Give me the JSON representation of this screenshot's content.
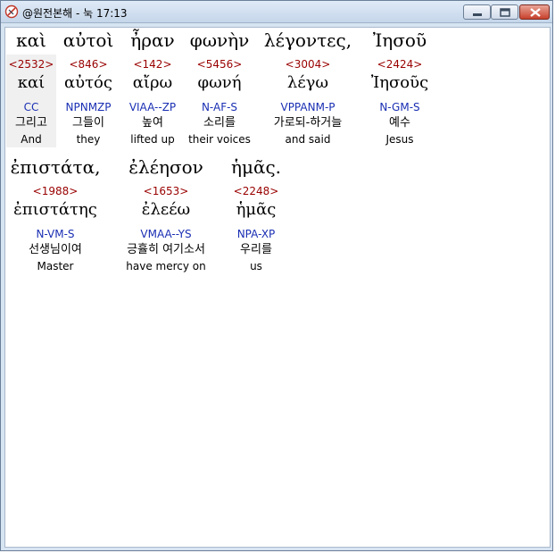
{
  "window": {
    "title": "@원전본해 - 눅 17:13"
  },
  "verse_rows": [
    {
      "words": [
        {
          "greek": "καὶ",
          "strong": "<2532>",
          "lemma": "καί",
          "morph": "CC",
          "korean": "그리고",
          "english": "And"
        },
        {
          "greek": "αὐτοὶ",
          "strong": "<846>",
          "lemma": "αὐτός",
          "morph": "NPNMZP",
          "korean": "그들이",
          "english": "they"
        },
        {
          "greek": "ἦραν",
          "strong": "<142>",
          "lemma": "αἴρω",
          "morph": "VIAA--ZP",
          "korean": "높여",
          "english": "lifted up"
        },
        {
          "greek": "φωνὴν",
          "strong": "<5456>",
          "lemma": "φωνή",
          "morph": "N-AF-S",
          "korean": "소리를",
          "english": "their voices"
        },
        {
          "greek": "λέγοντες,",
          "strong": "<3004>",
          "lemma": "λέγω",
          "morph": "VPPANM-P",
          "korean": "가로되-하거늘",
          "english": "and said"
        },
        {
          "greek": "Ἰησοῦ",
          "strong": "<2424>",
          "lemma": "Ἰησοῦς",
          "morph": "N-GM-S",
          "korean": "예수",
          "english": "Jesus"
        }
      ]
    },
    {
      "words": [
        {
          "greek": "ἐπιστάτα,",
          "strong": "<1988>",
          "lemma": "ἐπιστάτης",
          "morph": "N-VM-S",
          "korean": "선생님이여",
          "english": "Master"
        },
        {
          "greek": "ἐλέησον",
          "strong": "<1653>",
          "lemma": "ἐλεέω",
          "morph": "VMAA--YS",
          "korean": "긍휼히 여기소서",
          "english": "have mercy on"
        },
        {
          "greek": "ἡμᾶς.",
          "strong": "<2248>",
          "lemma": "ἡμᾶς",
          "morph": "NPA-XP",
          "korean": "우리를",
          "english": "us"
        }
      ]
    }
  ]
}
